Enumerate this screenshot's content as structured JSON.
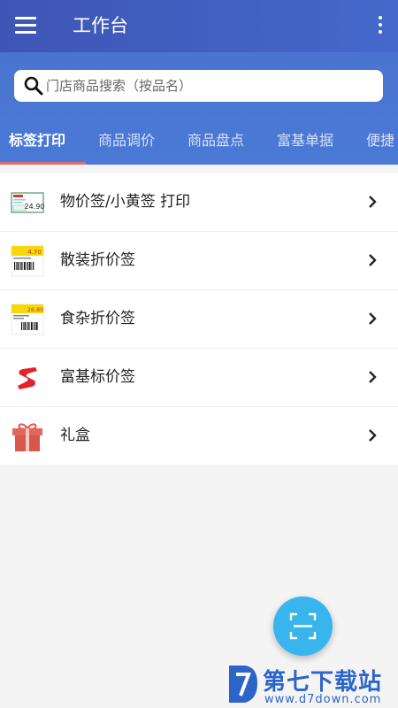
{
  "appbar": {
    "title": "工作台",
    "menu_icon": "menu-icon",
    "more_icon": "more-vert-icon"
  },
  "search": {
    "placeholder": "门店商品搜索（按品名）",
    "value": ""
  },
  "tabs": [
    {
      "label": "标签打印",
      "active": true
    },
    {
      "label": "商品调价",
      "active": false
    },
    {
      "label": "商品盘点",
      "active": false
    },
    {
      "label": "富基单据",
      "active": false
    },
    {
      "label": "便捷",
      "active": false
    }
  ],
  "list": {
    "items": [
      {
        "label": "物价签/小黄签 打印",
        "icon": "price-tag-icon",
        "tag_price": "24.90"
      },
      {
        "label": "散装折价签",
        "icon": "bulk-discount-label-icon",
        "tag_price": "4.70"
      },
      {
        "label": "食杂折价签",
        "icon": "grocery-discount-label-icon",
        "tag_price": "26.80"
      },
      {
        "label": "富基标价签",
        "icon": "fuji-logo-icon"
      },
      {
        "label": "礼盒",
        "icon": "gift-box-icon"
      }
    ]
  },
  "fab": {
    "icon": "scan-icon"
  },
  "watermark": {
    "name": "第七下载站",
    "url": "www.d7down.com"
  },
  "colors": {
    "appbar": "#3f55b5",
    "header": "#4a76d3",
    "tab_indicator": "#e26a6a",
    "fab": "#38b5ec",
    "watermark": "#2c64c8"
  }
}
